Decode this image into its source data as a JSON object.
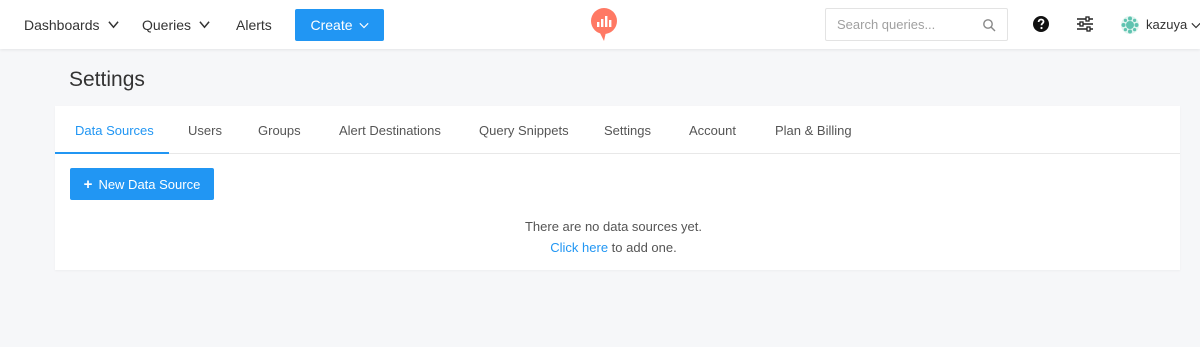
{
  "topbar": {
    "nav": {
      "dashboards": "Dashboards",
      "queries": "Queries",
      "alerts": "Alerts"
    },
    "create_label": "Create",
    "search_placeholder": "Search queries...",
    "user_name": "kazuya",
    "icons": {
      "logo": "redash-logo-icon",
      "search": "search-icon",
      "help": "question-circle-icon",
      "settings": "sliders-icon",
      "avatar": "avatar-icon"
    },
    "colors": {
      "accent": "#2196f3",
      "logo": "#ff7964"
    }
  },
  "page": {
    "title": "Settings",
    "tabs": [
      {
        "label": "Data Sources",
        "active": true
      },
      {
        "label": "Users",
        "active": false
      },
      {
        "label": "Groups",
        "active": false
      },
      {
        "label": "Alert Destinations",
        "active": false
      },
      {
        "label": "Query Snippets",
        "active": false
      },
      {
        "label": "Settings",
        "active": false
      },
      {
        "label": "Account",
        "active": false
      },
      {
        "label": "Plan & Billing",
        "active": false
      }
    ],
    "new_data_source_label": "New Data Source",
    "empty_state": {
      "message": "There are no data sources yet.",
      "link_text": "Click here",
      "suffix": " to add one."
    }
  }
}
